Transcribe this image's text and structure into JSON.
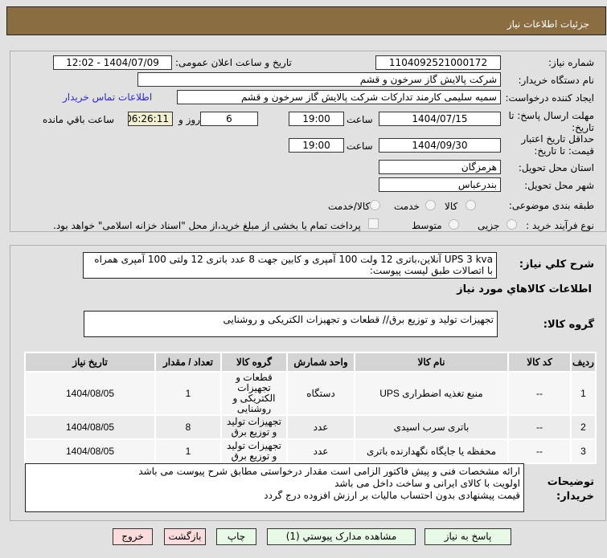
{
  "header": {
    "title": "جزئیات اطلاعات نیاز"
  },
  "form": {
    "need_number_label": "شماره نیاز:",
    "need_number": "1104092521000172",
    "announce_label": "تاریخ و ساعت اعلان عمومی:",
    "announce_value": "1404/07/09 - 12:02",
    "buyer_label": "نام دستگاه خریدار:",
    "buyer_value": "شرکت پالایش گاز سرخون و قشم",
    "creator_label": "ایجاد کننده درخواست:",
    "creator_value": "سمیه سلیمی کارمند تدارکات شرکت پالایش گاز سرخون و قشم",
    "contact_link": "اطلاعات تماس خریدار",
    "deadline_label": "مهلت ارسال پاسخ: تا تاریخ:",
    "deadline_date": "1404/07/15",
    "time_label": "ساعت",
    "deadline_time": "19:00",
    "days": "6",
    "days_label": "روز و",
    "remaining": "06:26:11",
    "remaining_label": "ساعت باقي مانده",
    "validity_label": "حداقل تاریخ اعتبار قیمت: تا تاریخ:",
    "validity_date": "1404/09/30",
    "validity_time": "19:00",
    "province_label": "استان محل تحویل:",
    "province": "هرمزگان",
    "city_label": "شهر محل تحویل:",
    "city": "بندرعباس",
    "category_label": "طبقه بندی موضوعی:",
    "category_options": [
      "کالا",
      "خدمت",
      "کالا/خدمت"
    ],
    "process_label": "نوع فرآیند خرید :",
    "process_options": [
      "جزیی",
      "متوسط"
    ],
    "payment_note": "پرداخت تمام یا بخشی از مبلغ خرید،از محل \"اسناد خزانه اسلامی\" خواهد بود."
  },
  "details": {
    "summary_label": "شرح کلي نیاز:",
    "summary": "UPS 3 kva آنلاین،باتری 12 ولت 100 آمپری و کابین جهت 8 عدد باتری 12 ولتی 100 آمپری همراه با اتصالات طبق لیست پیوست:",
    "goods_heading": "اطلاعات کالاهاي مورد نیاز",
    "group_label": "گروه کالا:",
    "group_value": "تجهیزات تولید و توزیع برق// قطعات و تجهیزات الکتریکی و روشنایی",
    "table": {
      "headers": [
        "ردیف",
        "کد کالا",
        "نام کالا",
        "واحد شمارش",
        "گروه کالا",
        "تعداد / مقدار",
        "تاریخ نیاز"
      ],
      "rows": [
        [
          "1",
          "--",
          "منبع تغذیه اضطراری UPS",
          "دستگاه",
          "قطعات و تجهیزات الکتریکی و روشنایی",
          "1",
          "1404/08/05"
        ],
        [
          "2",
          "--",
          "باتری سرب اسیدی",
          "عدد",
          "تجهیزات تولید و توزیع برق",
          "8",
          "1404/08/05"
        ],
        [
          "3",
          "--",
          "محفظه یا جایگاه نگهدارنده باتری",
          "عدد",
          "تجهیزات تولید و توزیع برق",
          "1",
          "1404/08/05"
        ]
      ]
    },
    "notes_label": "توضیحات خریدار:",
    "notes": [
      "ارائه مشخصات فنی و پیش فاکتور الزامی است مقدار درخواستی مطابق شرح پیوست می باشد",
      "اولویت با کالای ایرانی و ساخت داخل می باشد",
      "قیمت پیشنهادی بدون احتساب مالیات بر ارزش افزوده درج گردد"
    ]
  },
  "buttons": {
    "reply": "پاسخ به نیاز",
    "attachments": "مشاهده مدارک پیوستي (1)",
    "print": "چاپ",
    "back": "بازگشت",
    "exit": "خروج"
  }
}
